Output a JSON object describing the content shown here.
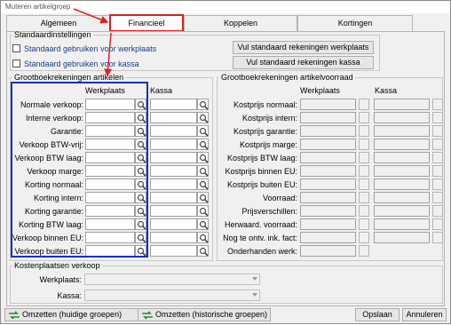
{
  "window": {
    "title": "Muteren artikelgroep"
  },
  "tabs": [
    {
      "label": "Algemeen"
    },
    {
      "label": "Financieel"
    },
    {
      "label": "Koppelen"
    },
    {
      "label": "Kortingen"
    }
  ],
  "standaard": {
    "legend": "Standaardinstellingen",
    "chk_werkplaats": "Standaard gebruiken voor werkplaats",
    "chk_kassa": "Standaard gebruiken voor kassa",
    "btn_werkplaats": "Vul standaard rekeningen werkplaats",
    "btn_kassa": "Vul standaard rekeningen kassa"
  },
  "artikelen": {
    "legend": "Grootboekrekeningen artikelen",
    "col_werkplaats": "Werkplaats",
    "col_kassa": "Kassa",
    "rows": [
      "Normale verkoop:",
      "Interne verkoop:",
      "Garantie:",
      "Verkoop BTW-vrij:",
      "Verkoop BTW laag:",
      "Verkoop marge:",
      "Korting normaal:",
      "Korting intern:",
      "Korting garantie:",
      "Korting BTW laag:",
      "Verkoop binnen EU:",
      "Verkoop buiten EU:"
    ]
  },
  "voorraad": {
    "legend": "Grootboekrekeningen artikelvoorraad",
    "col_werkplaats": "Werkplaats",
    "col_kassa": "Kassa",
    "rows": [
      "Kostprijs normaal:",
      "Kostprijs intern:",
      "Kostprijs garantie:",
      "Kostprijs marge:",
      "Kostprijs BTW laag:",
      "Kostprijs binnen EU:",
      "Kostprijs buiten EU:",
      "Voorraad:",
      "Prijsverschillen:",
      "Herwaard. voorraad:",
      "Nog te ontv. ink. fact:",
      "Onderhanden werk:"
    ]
  },
  "kosten": {
    "legend": "Kostenplaatsen verkoop",
    "werkplaats_label": "Werkplaats:",
    "kassa_label": "Kassa:"
  },
  "bottom": {
    "omzetten_huidig": "Omzetten (huidige groepen)",
    "omzetten_hist": "Omzetten (historische groepen)",
    "opslaan": "Opslaan",
    "annuleren": "Annuleren"
  },
  "colors": {
    "highlight_red": "#e02020",
    "highlight_blue": "#1a2fbf"
  }
}
